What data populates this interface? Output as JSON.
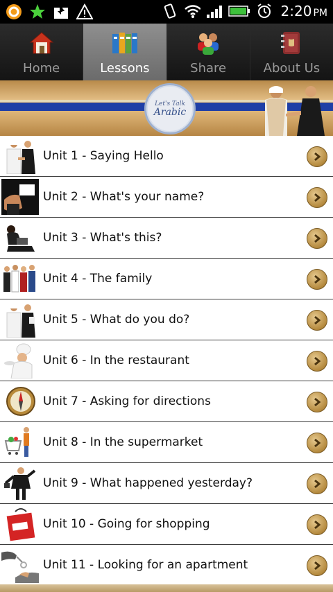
{
  "status_bar": {
    "time": "2:20",
    "ampm": "PM"
  },
  "tabs": [
    {
      "label": "Home",
      "icon": "home-icon",
      "active": false
    },
    {
      "label": "Lessons",
      "icon": "books-icon",
      "active": true
    },
    {
      "label": "Share",
      "icon": "people-icon",
      "active": false
    },
    {
      "label": "About Us",
      "icon": "address-book-icon",
      "active": false
    }
  ],
  "banner": {
    "logo_top": "Let's Talk",
    "logo_main": "Arabic"
  },
  "lessons": [
    {
      "label": "Unit 1 - Saying Hello",
      "thumb": "handshake-icon"
    },
    {
      "label": "Unit 2 - What's your name?",
      "thumb": "business-card-icon"
    },
    {
      "label": "Unit 3 - What's this?",
      "thumb": "laptop-person-icon"
    },
    {
      "label": "Unit 4 - The family",
      "thumb": "family-group-icon"
    },
    {
      "label": "Unit 5 - What do you do?",
      "thumb": "professions-icon"
    },
    {
      "label": "Unit 6 - In the restaurant",
      "thumb": "chef-icon"
    },
    {
      "label": "Unit 7 - Asking for directions",
      "thumb": "compass-icon"
    },
    {
      "label": "Unit 8 - In the supermarket",
      "thumb": "shopping-cart-icon"
    },
    {
      "label": "Unit 9 - What happened yesterday?",
      "thumb": "businessman-icon"
    },
    {
      "label": "Unit 10 - Going for shopping",
      "thumb": "sale-bag-icon"
    },
    {
      "label": "Unit 11 - Looking for an apartment",
      "thumb": "keys-icon"
    }
  ]
}
